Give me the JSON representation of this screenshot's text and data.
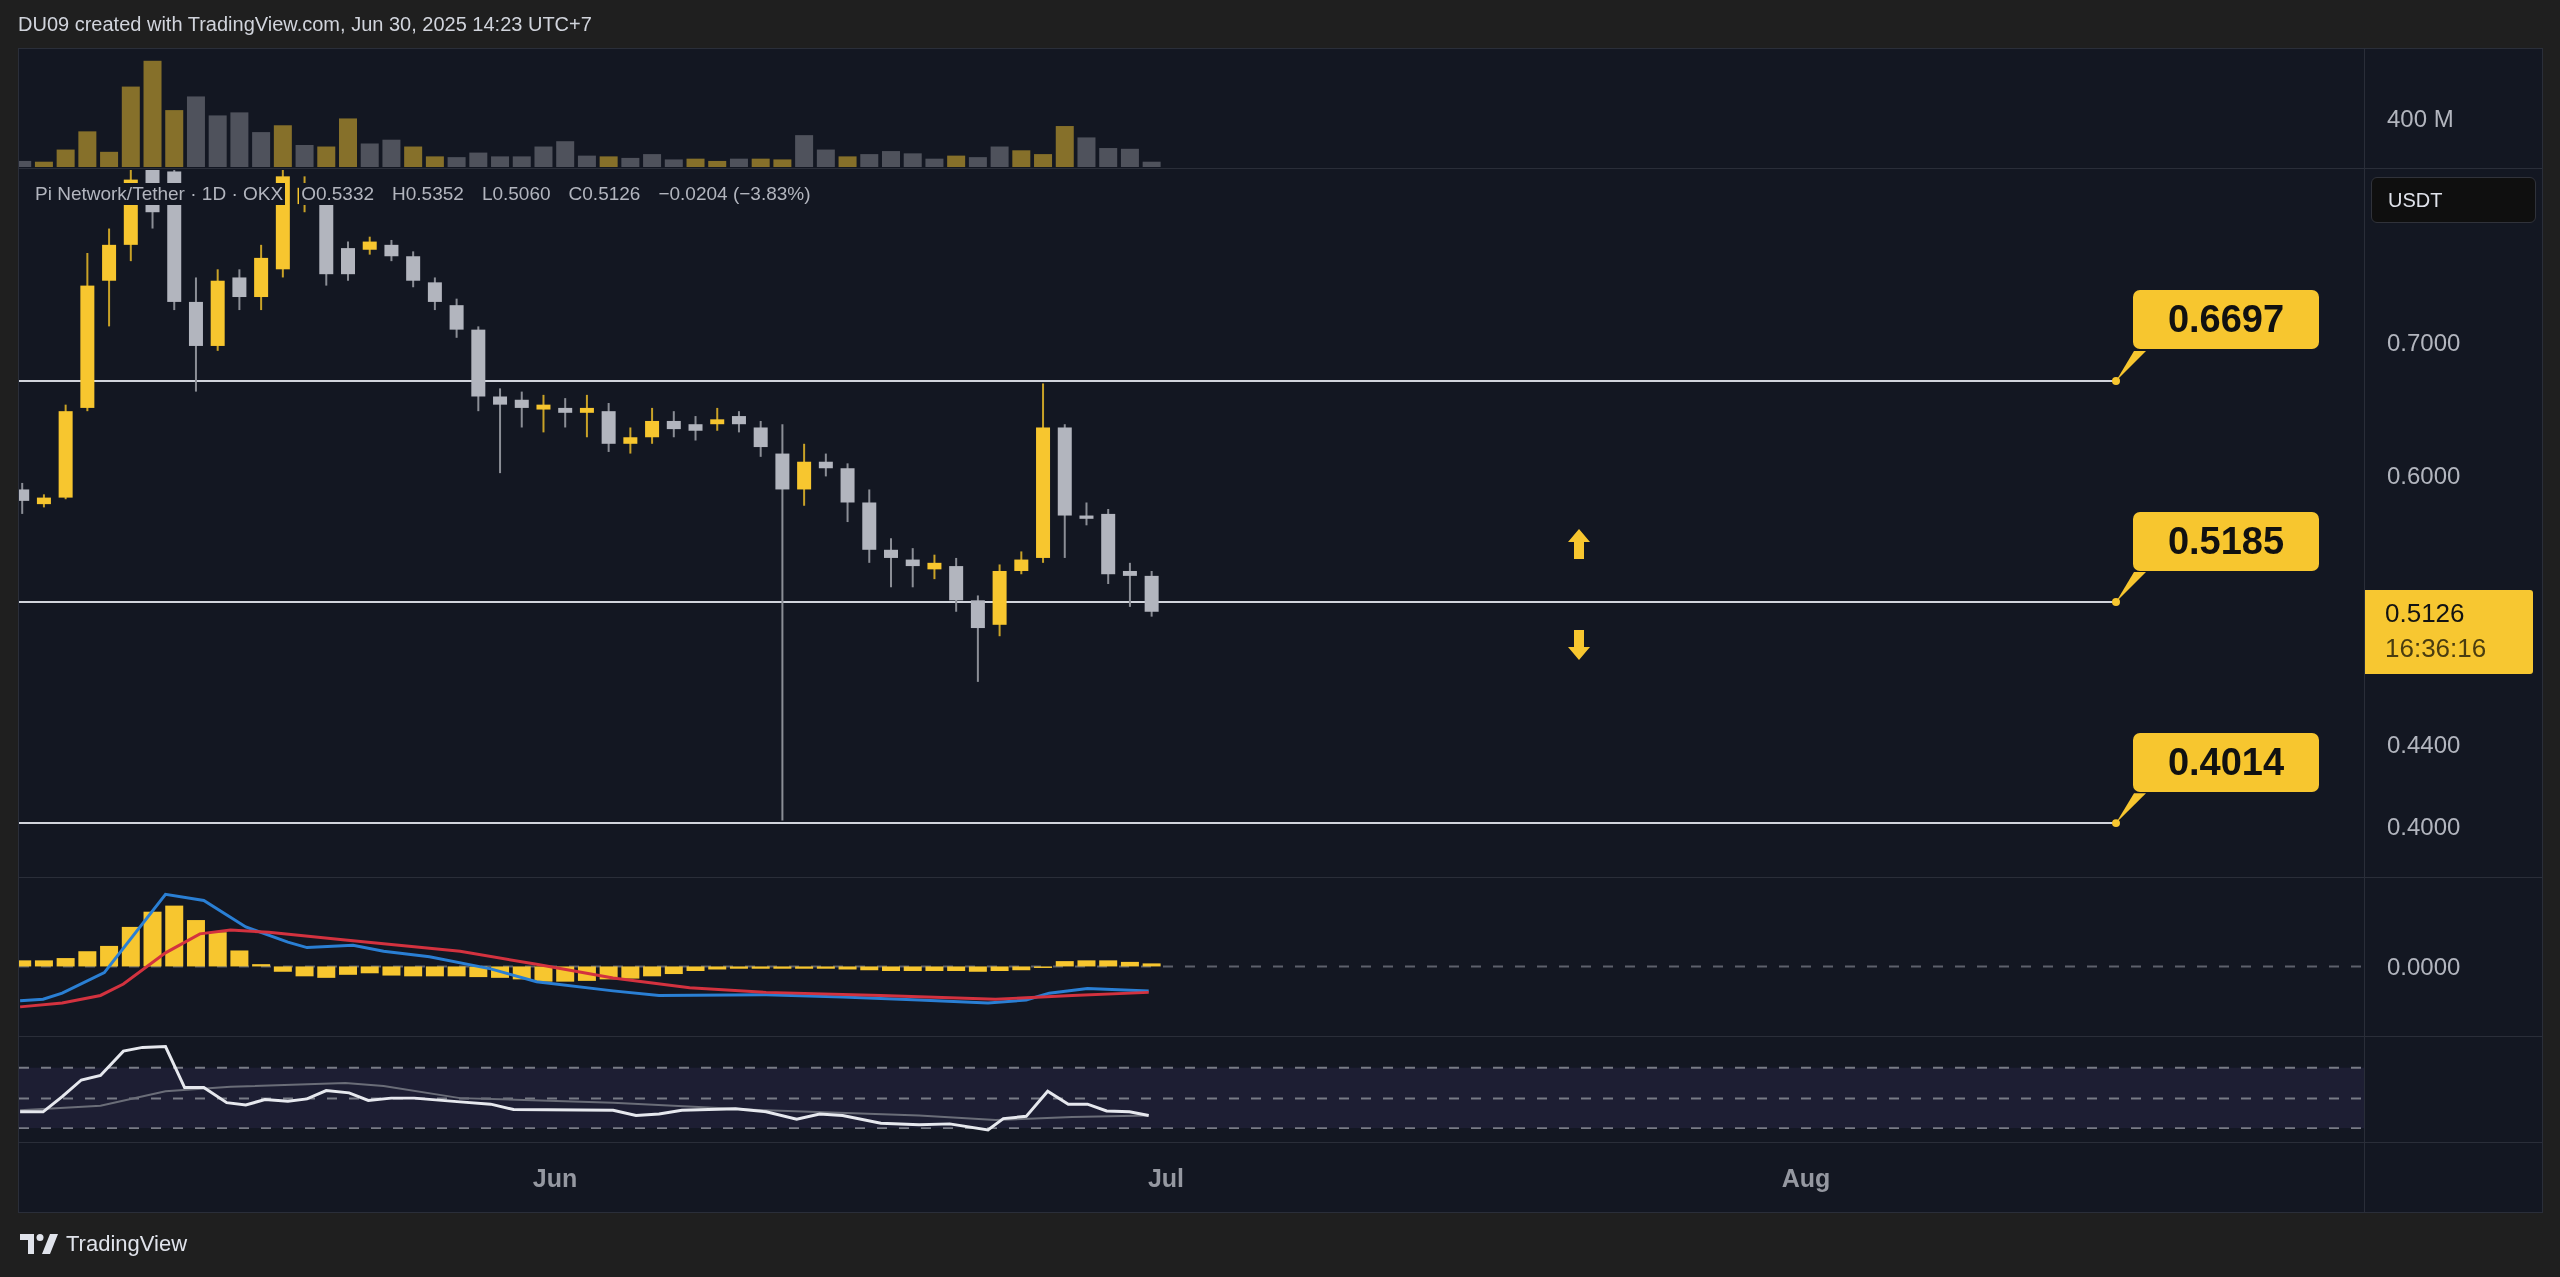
{
  "header": {
    "text": "DU09 created with TradingView.com, Jun 30, 2025 14:23 UTC+7"
  },
  "legend": {
    "symbol": "Pi Network/Tether · 1D · OKX",
    "values": [
      "O0.5332",
      "H0.5352",
      "L0.5060",
      "C0.5126"
    ],
    "change": "−0.0204 (−3.83%)"
  },
  "volume_pane": {
    "scale_label": "400 M"
  },
  "price_pane": {
    "currency": "USDT",
    "ticks": [
      "0.7000",
      "0.6000",
      "0.4400",
      "0.4000"
    ],
    "levels": [
      {
        "price": "0.6697"
      },
      {
        "price": "0.5185"
      },
      {
        "price": "0.4014"
      }
    ],
    "last_price": {
      "price": "0.5126",
      "countdown": "16:36:16"
    },
    "arrows": [
      {
        "kind": "up"
      },
      {
        "kind": "down"
      }
    ]
  },
  "macd_pane": {
    "ticks": [
      "0.0000"
    ]
  },
  "time_axis": {
    "labels": [
      "Jun",
      "Jul",
      "Aug"
    ]
  },
  "footer": {
    "brand": "TradingView"
  }
}
